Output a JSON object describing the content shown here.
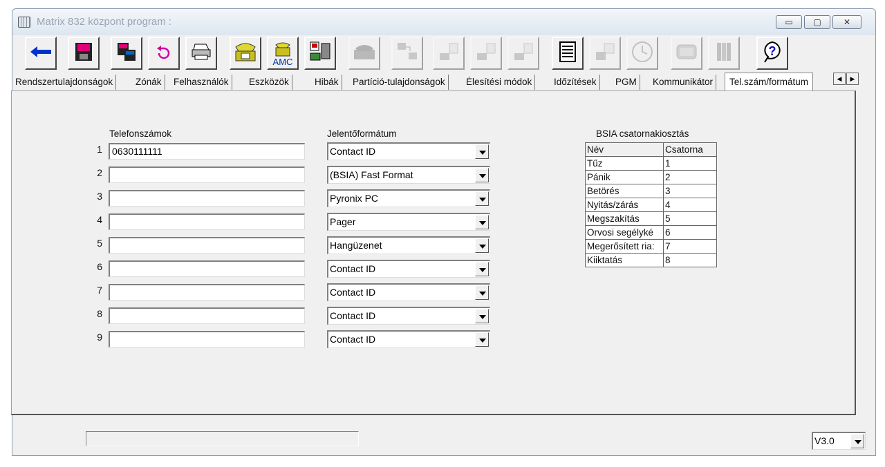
{
  "window": {
    "title": "Matrix 832 központ program :",
    "controls": {
      "minimize": "▭",
      "maximize": "▢",
      "close": "✕"
    }
  },
  "toolbar": {
    "buttons": [
      {
        "icon": "back-arrow-icon"
      },
      {
        "icon": "save-disk-icon"
      },
      {
        "icon": "save-as-icon"
      },
      {
        "icon": "undo-icon"
      },
      {
        "icon": "printer-icon"
      },
      {
        "icon": "telephone-icon"
      },
      {
        "icon": "amc-telephone-icon",
        "label": "AMC"
      },
      {
        "icon": "network-computer-icon"
      },
      {
        "icon": "fax-icon",
        "disabled": true
      },
      {
        "icon": "transfer-computer-icon",
        "disabled": true
      },
      {
        "icon": "download-icon",
        "disabled": true
      },
      {
        "icon": "upload-icon",
        "disabled": true
      },
      {
        "icon": "send-icon",
        "disabled": true
      },
      {
        "icon": "document-list-icon"
      },
      {
        "icon": "sync-icon",
        "disabled": true
      },
      {
        "icon": "clock-icon",
        "disabled": true
      },
      {
        "icon": "keypad-icon",
        "disabled": true
      },
      {
        "icon": "books-icon",
        "disabled": true
      },
      {
        "icon": "help-icon"
      }
    ]
  },
  "tabs": [
    "Rendszertulajdonságok",
    "Zónák",
    "Felhasználók",
    "Eszközök",
    "Hibák",
    "Partíció-tulajdonságok",
    "Élesítési módok",
    "Időzítések",
    "PGM",
    "Kommunikátor",
    "Tel.szám/formátum"
  ],
  "active_tab": "Tel.szám/formátum",
  "phones": {
    "header": "Telefonszámok",
    "rows": [
      {
        "n": "1",
        "value": "0630111111"
      },
      {
        "n": "2",
        "value": ""
      },
      {
        "n": "3",
        "value": ""
      },
      {
        "n": "4",
        "value": ""
      },
      {
        "n": "5",
        "value": ""
      },
      {
        "n": "6",
        "value": ""
      },
      {
        "n": "7",
        "value": ""
      },
      {
        "n": "8",
        "value": ""
      },
      {
        "n": "9",
        "value": ""
      }
    ]
  },
  "formats": {
    "header": "Jelentőformátum",
    "values": [
      "Contact ID",
      "(BSIA) Fast Format",
      "Pyronix PC",
      "Pager",
      "Hangüzenet",
      "Contact ID",
      "Contact ID",
      "Contact ID",
      "Contact ID"
    ]
  },
  "bsia": {
    "title": "BSIA csatornakiosztás",
    "col_name": "Név",
    "col_channel": "Csatorna",
    "rows": [
      {
        "name": "Tűz",
        "channel": "1"
      },
      {
        "name": "Pánik",
        "channel": "2"
      },
      {
        "name": "Betörés",
        "channel": "3"
      },
      {
        "name": "Nyitás/zárás",
        "channel": "4"
      },
      {
        "name": "Megszakítás",
        "channel": "5"
      },
      {
        "name": "Orvosi segélyké",
        "channel": "6"
      },
      {
        "name": "Megerősített ria:",
        "channel": "7"
      },
      {
        "name": "Kiiktatás",
        "channel": "8"
      }
    ]
  },
  "version": "V3.0"
}
